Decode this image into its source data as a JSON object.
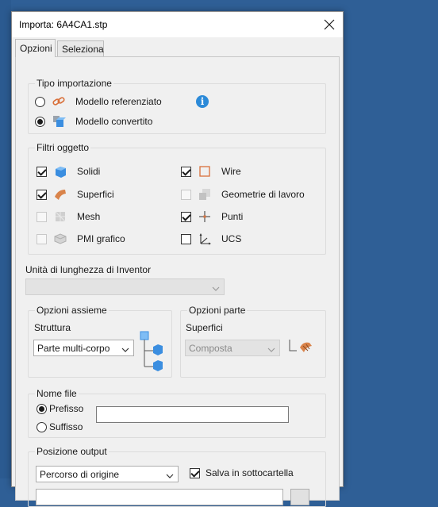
{
  "dialog": {
    "title": "Importa:  6A4CA1.stp",
    "close_icon": "close-icon"
  },
  "tabs": [
    {
      "label": "Opzioni",
      "active": true
    },
    {
      "label": "Seleziona",
      "active": false
    }
  ],
  "tipo_importazione": {
    "title": "Tipo importazione",
    "options": [
      {
        "label": "Modello referenziato",
        "selected": false,
        "icon": "link-icon"
      },
      {
        "label": "Modello convertito",
        "selected": true,
        "icon": "converted-model-icon"
      }
    ],
    "info_icon": "info-icon"
  },
  "filtri_oggetto": {
    "title": "Filtri oggetto",
    "left": [
      {
        "label": "Solidi",
        "checked": true,
        "enabled": true,
        "icon": "solid-cube-icon"
      },
      {
        "label": "Superfici",
        "checked": true,
        "enabled": true,
        "icon": "surface-icon"
      },
      {
        "label": "Mesh",
        "checked": false,
        "enabled": false,
        "icon": "mesh-icon"
      },
      {
        "label": "PMI grafico",
        "checked": false,
        "enabled": false,
        "icon": "pmi-icon"
      }
    ],
    "right": [
      {
        "label": "Wire",
        "checked": true,
        "enabled": true,
        "icon": "wire-icon"
      },
      {
        "label": "Geometrie di lavoro",
        "checked": false,
        "enabled": false,
        "icon": "work-geometry-icon"
      },
      {
        "label": "Punti",
        "checked": true,
        "enabled": true,
        "icon": "point-icon"
      },
      {
        "label": "UCS",
        "checked": false,
        "enabled": true,
        "icon": "ucs-icon"
      }
    ]
  },
  "unita": {
    "label": "Unità di lunghezza di Inventor",
    "value": ""
  },
  "opzioni_assieme": {
    "title": "Opzioni assieme",
    "struttura_label": "Struttura",
    "struttura_value": "Parte multi-corpo",
    "icon": "assembly-structure-icon"
  },
  "opzioni_parte": {
    "title": "Opzioni parte",
    "superfici_label": "Superfici",
    "superfici_value": "Composta",
    "icon": "composite-surface-icon"
  },
  "nome_file": {
    "title": "Nome file",
    "options": [
      {
        "label": "Prefisso",
        "selected": true
      },
      {
        "label": "Suffisso",
        "selected": false
      }
    ],
    "value": ""
  },
  "posizione_output": {
    "title": "Posizione output",
    "path_value": "Percorso di origine",
    "subfolder_label": "Salva in sottocartella",
    "subfolder_checked": true
  },
  "colors": {
    "desktop": "#2f5f96",
    "dialog_bg": "#f0f0f0",
    "accent_blue": "#2c8ad8",
    "orange": "#d9703a"
  }
}
